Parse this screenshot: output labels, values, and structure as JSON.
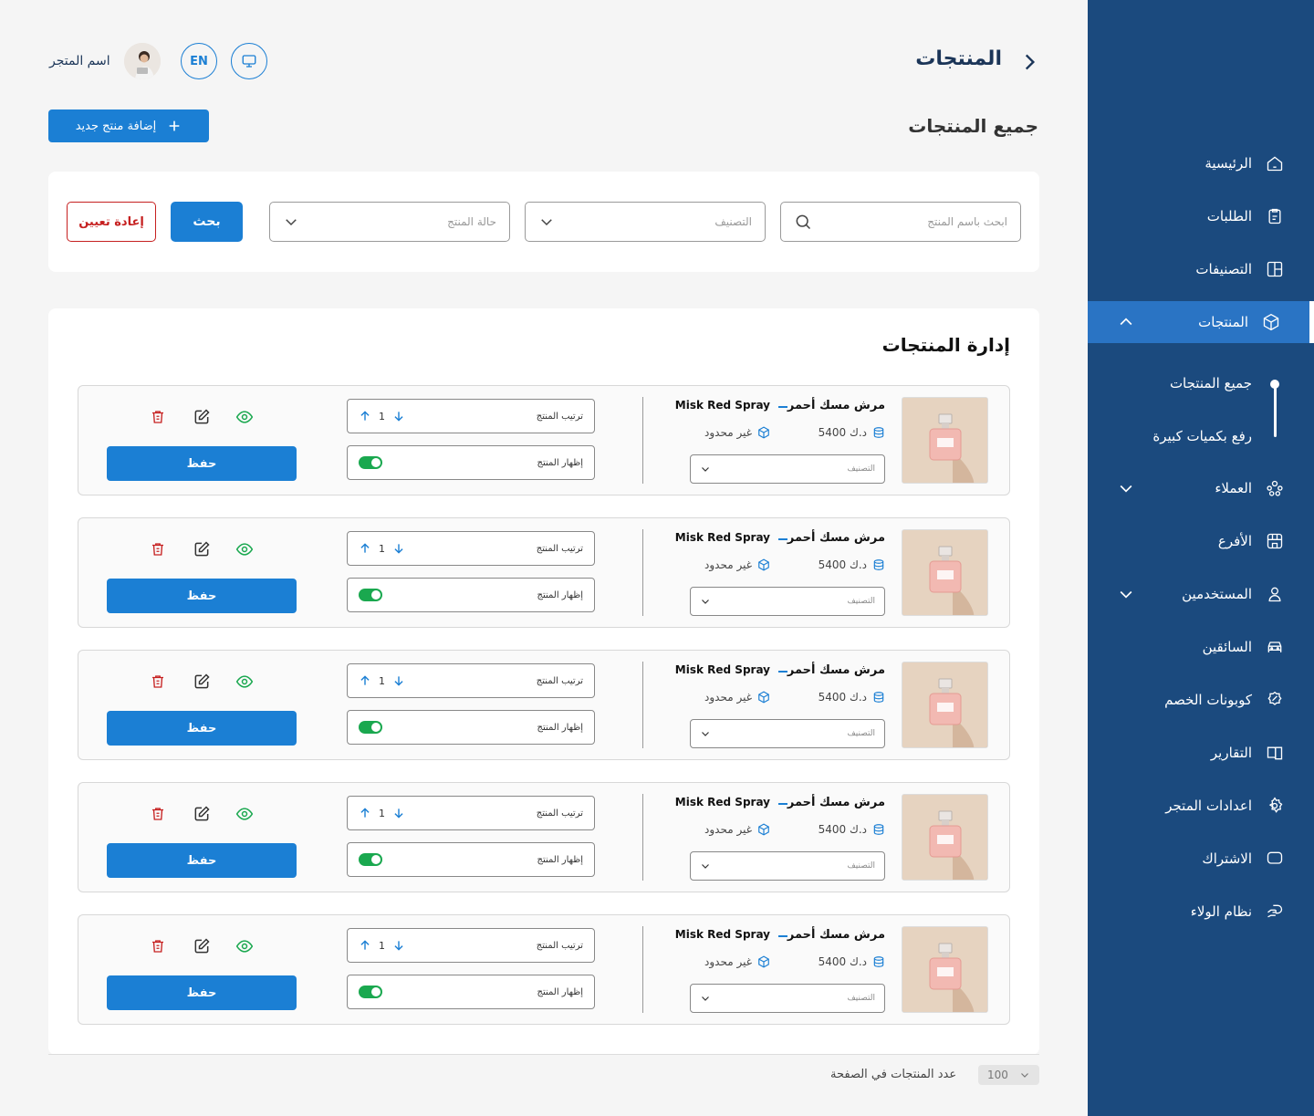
{
  "header": {
    "title": "المنتجات",
    "lang_label": "EN",
    "store_name": "اسم المتجر"
  },
  "page": {
    "subtitle": "جميع المنتجات",
    "add_button": "إضافة منتج جديد"
  },
  "filters": {
    "search_placeholder": "ابحث باسم المنتج",
    "category_placeholder": "التصنيف",
    "status_placeholder": "حالة المنتج",
    "search_button": "بحث",
    "reset_button": "إعادة تعيين"
  },
  "products": {
    "title": "إدارة المنتجات",
    "items": [
      {
        "name_ar": "مرش مسك أحمر",
        "name_en": "Misk Red Spray",
        "price": "5400 د.ك",
        "stock": "غير محدود",
        "category": "التصنيف",
        "order_label": "ترتيب المنتج",
        "order_value": "1",
        "visible_label": "إظهار المنتج",
        "visible": true,
        "save": "حفظ"
      },
      {
        "name_ar": "مرش مسك أحمر",
        "name_en": "Misk Red Spray",
        "price": "5400 د.ك",
        "stock": "غير محدود",
        "category": "التصنيف",
        "order_label": "ترتيب المنتج",
        "order_value": "1",
        "visible_label": "إظهار المنتج",
        "visible": true,
        "save": "حفظ"
      },
      {
        "name_ar": "مرش مسك أحمر",
        "name_en": "Misk Red Spray",
        "price": "5400 د.ك",
        "stock": "غير محدود",
        "category": "التصنيف",
        "order_label": "ترتيب المنتج",
        "order_value": "1",
        "visible_label": "إظهار المنتج",
        "visible": true,
        "save": "حفظ"
      },
      {
        "name_ar": "مرش مسك أحمر",
        "name_en": "Misk Red Spray",
        "price": "5400 د.ك",
        "stock": "غير محدود",
        "category": "التصنيف",
        "order_label": "ترتيب المنتج",
        "order_value": "1",
        "visible_label": "إظهار المنتج",
        "visible": true,
        "save": "حفظ"
      },
      {
        "name_ar": "مرش مسك أحمر",
        "name_en": "Misk Red Spray",
        "price": "5400 د.ك",
        "stock": "غير محدود",
        "category": "التصنيف",
        "order_label": "ترتيب المنتج",
        "order_value": "1",
        "visible_label": "إظهار المنتج",
        "visible": true,
        "save": "حفظ"
      }
    ]
  },
  "footer": {
    "per_page_label": "عدد المنتجات في الصفحة",
    "per_page_value": "100"
  },
  "sidebar": {
    "items": [
      {
        "label": "الرئيسية",
        "icon": "home-icon"
      },
      {
        "label": "الطلبات",
        "icon": "clipboard-icon"
      },
      {
        "label": "التصنيفات",
        "icon": "layout-icon"
      },
      {
        "label": "المنتجات",
        "icon": "box-icon"
      },
      {
        "label": "العملاء",
        "icon": "users-icon"
      },
      {
        "label": "الأفرع",
        "icon": "store-icon"
      },
      {
        "label": "المستخدمين",
        "icon": "user-icon"
      },
      {
        "label": "السائقين",
        "icon": "car-icon"
      },
      {
        "label": "كوبونات الخصم",
        "icon": "discount-icon"
      },
      {
        "label": "التقارير",
        "icon": "book-icon"
      },
      {
        "label": "اعدادات المتجر",
        "icon": "gear-icon"
      },
      {
        "label": "الاشتراك",
        "icon": "chat-icon"
      },
      {
        "label": "نظام الولاء",
        "icon": "loyalty-icon"
      }
    ],
    "sub_items": [
      {
        "label": "جميع المنتجات"
      },
      {
        "label": "رفع بكميات كبيرة"
      }
    ]
  },
  "colors": {
    "sidebar_bg": "#1b4a7e",
    "sidebar_active": "#2a74c4",
    "primary": "#1b7fd4",
    "danger": "#c62020",
    "success": "#1aa84f"
  }
}
